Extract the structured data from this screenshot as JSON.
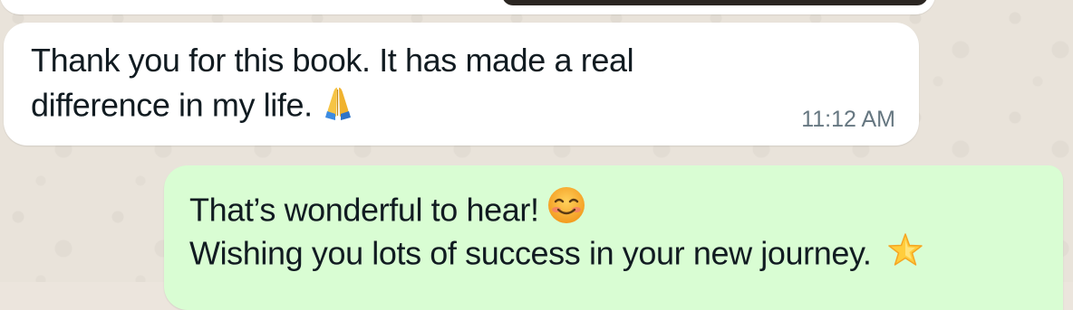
{
  "chat": {
    "messages": [
      {
        "direction": "incoming",
        "line1": "Thank you for this book. It has made a real",
        "line2": "difference in my life.",
        "emoji": "folded-hands-emoji",
        "time": "11:12 AM"
      },
      {
        "direction": "outgoing",
        "line1": "That’s wonderful to hear!",
        "line1_emoji": "smiling-face-emoji",
        "line2": "Wishing you lots of success in your new journey.",
        "line2_emoji": "glowing-star-emoji"
      }
    ]
  },
  "colors": {
    "incoming_bubble": "#ffffff",
    "outgoing_bubble": "#d9fdd3",
    "wallpaper": "#e9e3da",
    "timestamp": "#667781"
  }
}
